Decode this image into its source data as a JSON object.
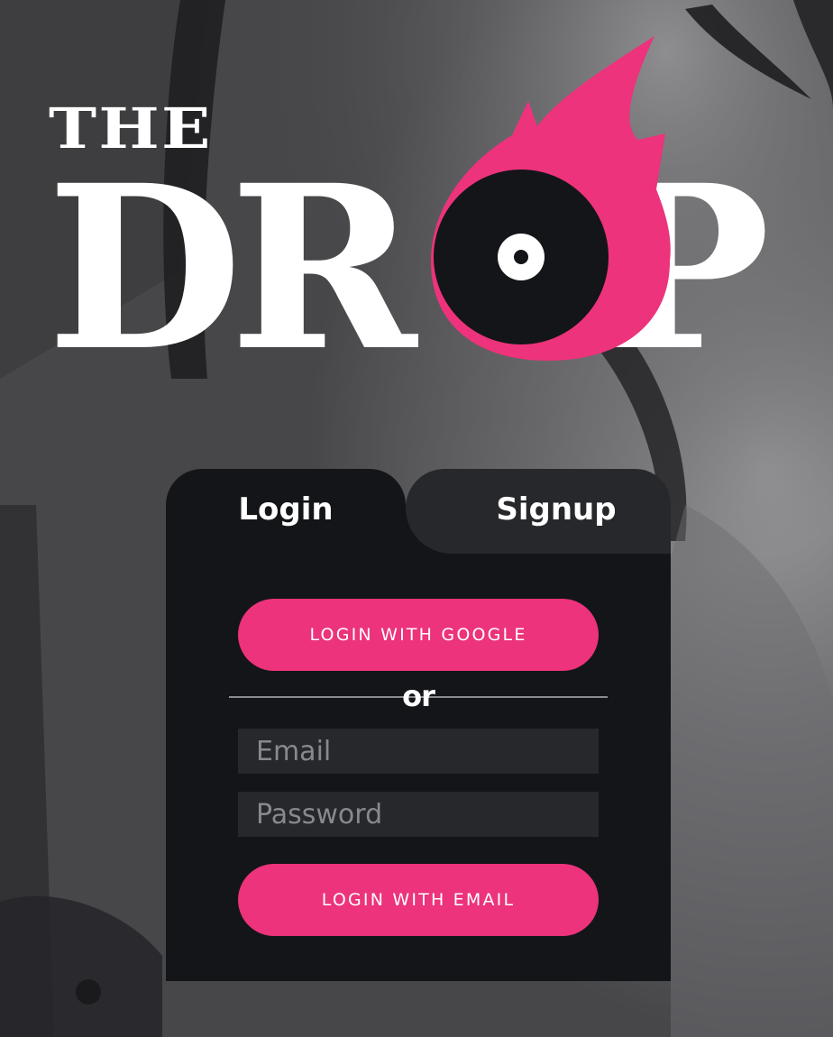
{
  "logo": {
    "the": "THE",
    "word_left": "DR",
    "word_right": "P"
  },
  "tabs": {
    "login": "Login",
    "signup": "Signup"
  },
  "form": {
    "google_button": "LOGIN WITH GOOGLE",
    "divider_text": "or",
    "email_placeholder": "Email",
    "password_placeholder": "Password",
    "email_button": "LOGIN WITH EMAIL"
  },
  "colors": {
    "accent": "#ec337b",
    "panel": "#141518",
    "tab_inactive": "#27282b",
    "input_bg": "#27282b"
  }
}
